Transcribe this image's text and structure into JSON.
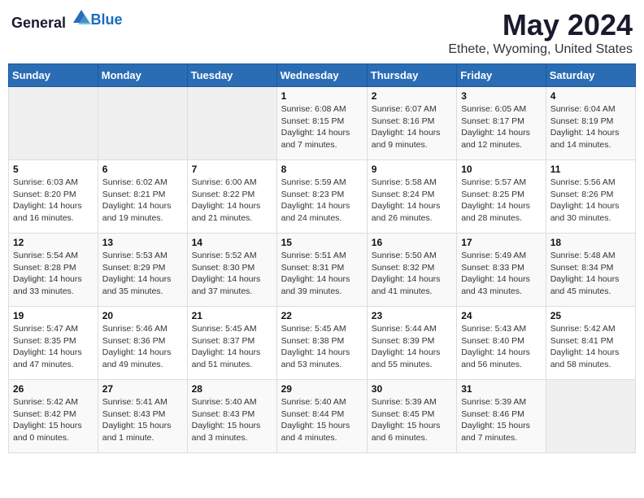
{
  "header": {
    "logo_general": "General",
    "logo_blue": "Blue",
    "month_title": "May 2024",
    "location": "Ethete, Wyoming, United States"
  },
  "weekdays": [
    "Sunday",
    "Monday",
    "Tuesday",
    "Wednesday",
    "Thursday",
    "Friday",
    "Saturday"
  ],
  "weeks": [
    [
      {
        "day": "",
        "sunrise": "",
        "sunset": "",
        "daylight": ""
      },
      {
        "day": "",
        "sunrise": "",
        "sunset": "",
        "daylight": ""
      },
      {
        "day": "",
        "sunrise": "",
        "sunset": "",
        "daylight": ""
      },
      {
        "day": "1",
        "sunrise": "Sunrise: 6:08 AM",
        "sunset": "Sunset: 8:15 PM",
        "daylight": "Daylight: 14 hours and 7 minutes."
      },
      {
        "day": "2",
        "sunrise": "Sunrise: 6:07 AM",
        "sunset": "Sunset: 8:16 PM",
        "daylight": "Daylight: 14 hours and 9 minutes."
      },
      {
        "day": "3",
        "sunrise": "Sunrise: 6:05 AM",
        "sunset": "Sunset: 8:17 PM",
        "daylight": "Daylight: 14 hours and 12 minutes."
      },
      {
        "day": "4",
        "sunrise": "Sunrise: 6:04 AM",
        "sunset": "Sunset: 8:19 PM",
        "daylight": "Daylight: 14 hours and 14 minutes."
      }
    ],
    [
      {
        "day": "5",
        "sunrise": "Sunrise: 6:03 AM",
        "sunset": "Sunset: 8:20 PM",
        "daylight": "Daylight: 14 hours and 16 minutes."
      },
      {
        "day": "6",
        "sunrise": "Sunrise: 6:02 AM",
        "sunset": "Sunset: 8:21 PM",
        "daylight": "Daylight: 14 hours and 19 minutes."
      },
      {
        "day": "7",
        "sunrise": "Sunrise: 6:00 AM",
        "sunset": "Sunset: 8:22 PM",
        "daylight": "Daylight: 14 hours and 21 minutes."
      },
      {
        "day": "8",
        "sunrise": "Sunrise: 5:59 AM",
        "sunset": "Sunset: 8:23 PM",
        "daylight": "Daylight: 14 hours and 24 minutes."
      },
      {
        "day": "9",
        "sunrise": "Sunrise: 5:58 AM",
        "sunset": "Sunset: 8:24 PM",
        "daylight": "Daylight: 14 hours and 26 minutes."
      },
      {
        "day": "10",
        "sunrise": "Sunrise: 5:57 AM",
        "sunset": "Sunset: 8:25 PM",
        "daylight": "Daylight: 14 hours and 28 minutes."
      },
      {
        "day": "11",
        "sunrise": "Sunrise: 5:56 AM",
        "sunset": "Sunset: 8:26 PM",
        "daylight": "Daylight: 14 hours and 30 minutes."
      }
    ],
    [
      {
        "day": "12",
        "sunrise": "Sunrise: 5:54 AM",
        "sunset": "Sunset: 8:28 PM",
        "daylight": "Daylight: 14 hours and 33 minutes."
      },
      {
        "day": "13",
        "sunrise": "Sunrise: 5:53 AM",
        "sunset": "Sunset: 8:29 PM",
        "daylight": "Daylight: 14 hours and 35 minutes."
      },
      {
        "day": "14",
        "sunrise": "Sunrise: 5:52 AM",
        "sunset": "Sunset: 8:30 PM",
        "daylight": "Daylight: 14 hours and 37 minutes."
      },
      {
        "day": "15",
        "sunrise": "Sunrise: 5:51 AM",
        "sunset": "Sunset: 8:31 PM",
        "daylight": "Daylight: 14 hours and 39 minutes."
      },
      {
        "day": "16",
        "sunrise": "Sunrise: 5:50 AM",
        "sunset": "Sunset: 8:32 PM",
        "daylight": "Daylight: 14 hours and 41 minutes."
      },
      {
        "day": "17",
        "sunrise": "Sunrise: 5:49 AM",
        "sunset": "Sunset: 8:33 PM",
        "daylight": "Daylight: 14 hours and 43 minutes."
      },
      {
        "day": "18",
        "sunrise": "Sunrise: 5:48 AM",
        "sunset": "Sunset: 8:34 PM",
        "daylight": "Daylight: 14 hours and 45 minutes."
      }
    ],
    [
      {
        "day": "19",
        "sunrise": "Sunrise: 5:47 AM",
        "sunset": "Sunset: 8:35 PM",
        "daylight": "Daylight: 14 hours and 47 minutes."
      },
      {
        "day": "20",
        "sunrise": "Sunrise: 5:46 AM",
        "sunset": "Sunset: 8:36 PM",
        "daylight": "Daylight: 14 hours and 49 minutes."
      },
      {
        "day": "21",
        "sunrise": "Sunrise: 5:45 AM",
        "sunset": "Sunset: 8:37 PM",
        "daylight": "Daylight: 14 hours and 51 minutes."
      },
      {
        "day": "22",
        "sunrise": "Sunrise: 5:45 AM",
        "sunset": "Sunset: 8:38 PM",
        "daylight": "Daylight: 14 hours and 53 minutes."
      },
      {
        "day": "23",
        "sunrise": "Sunrise: 5:44 AM",
        "sunset": "Sunset: 8:39 PM",
        "daylight": "Daylight: 14 hours and 55 minutes."
      },
      {
        "day": "24",
        "sunrise": "Sunrise: 5:43 AM",
        "sunset": "Sunset: 8:40 PM",
        "daylight": "Daylight: 14 hours and 56 minutes."
      },
      {
        "day": "25",
        "sunrise": "Sunrise: 5:42 AM",
        "sunset": "Sunset: 8:41 PM",
        "daylight": "Daylight: 14 hours and 58 minutes."
      }
    ],
    [
      {
        "day": "26",
        "sunrise": "Sunrise: 5:42 AM",
        "sunset": "Sunset: 8:42 PM",
        "daylight": "Daylight: 15 hours and 0 minutes."
      },
      {
        "day": "27",
        "sunrise": "Sunrise: 5:41 AM",
        "sunset": "Sunset: 8:43 PM",
        "daylight": "Daylight: 15 hours and 1 minute."
      },
      {
        "day": "28",
        "sunrise": "Sunrise: 5:40 AM",
        "sunset": "Sunset: 8:43 PM",
        "daylight": "Daylight: 15 hours and 3 minutes."
      },
      {
        "day": "29",
        "sunrise": "Sunrise: 5:40 AM",
        "sunset": "Sunset: 8:44 PM",
        "daylight": "Daylight: 15 hours and 4 minutes."
      },
      {
        "day": "30",
        "sunrise": "Sunrise: 5:39 AM",
        "sunset": "Sunset: 8:45 PM",
        "daylight": "Daylight: 15 hours and 6 minutes."
      },
      {
        "day": "31",
        "sunrise": "Sunrise: 5:39 AM",
        "sunset": "Sunset: 8:46 PM",
        "daylight": "Daylight: 15 hours and 7 minutes."
      },
      {
        "day": "",
        "sunrise": "",
        "sunset": "",
        "daylight": ""
      }
    ]
  ]
}
